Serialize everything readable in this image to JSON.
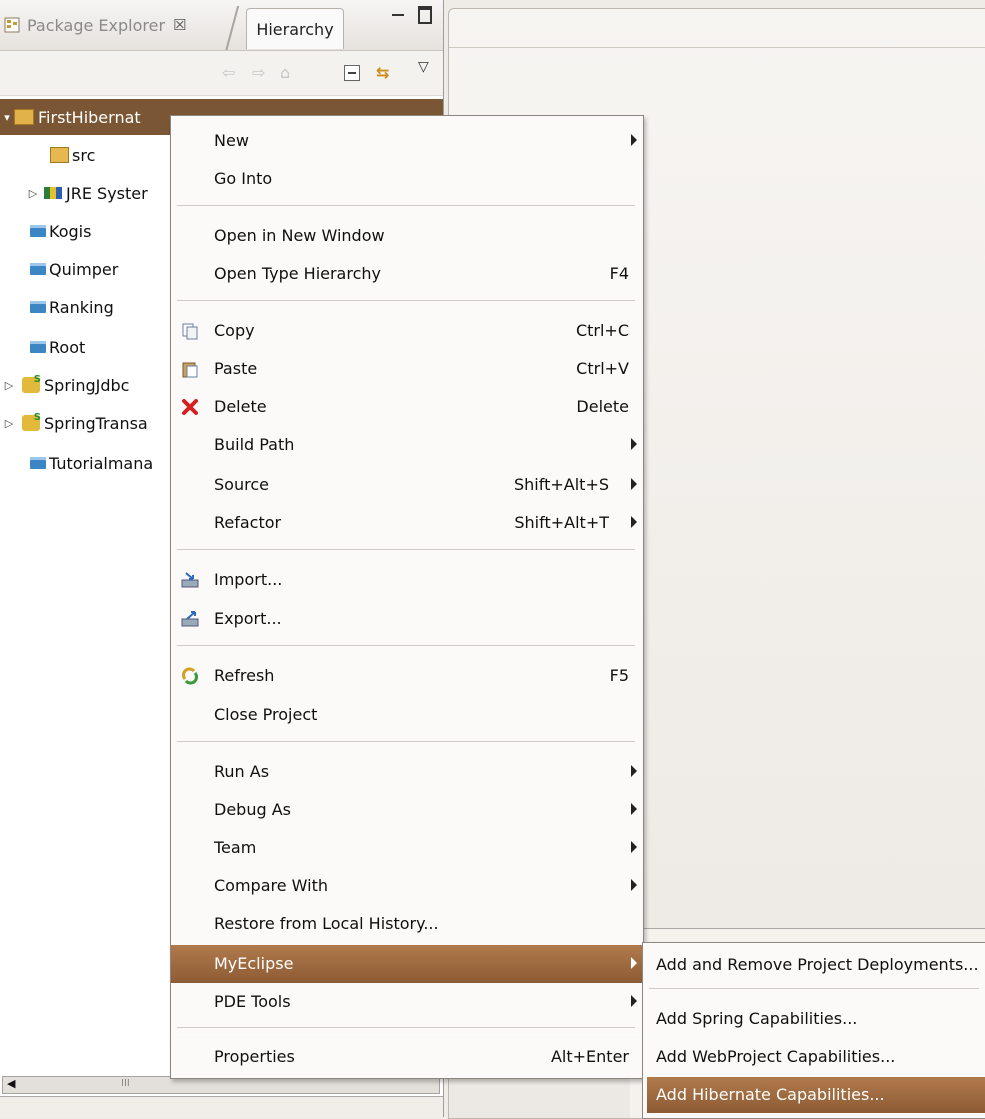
{
  "explorer": {
    "tab_title": "Package Explorer",
    "tab_close": "☒",
    "hierarchy_tab": "Hierarchy",
    "toolbar": {
      "back": "⇦",
      "forward": "⇨",
      "home": "⌂",
      "link": "⇆",
      "menu": "▽"
    },
    "tree": [
      {
        "label": "FirstHibernat",
        "icon": "open-project-icon",
        "expander": "▾"
      },
      {
        "label": "src",
        "icon": "source-folder-icon"
      },
      {
        "label": "JRE Syster",
        "icon": "library-icon",
        "expander": "▷"
      },
      {
        "label": "Kogis",
        "icon": "folder-icon"
      },
      {
        "label": "Quimper",
        "icon": "folder-icon"
      },
      {
        "label": "Ranking",
        "icon": "folder-icon"
      },
      {
        "label": "Root",
        "icon": "folder-icon"
      },
      {
        "label": "SpringJdbc",
        "icon": "spring-project-icon",
        "expander": "▷"
      },
      {
        "label": "SpringTransa",
        "icon": "spring-project-icon",
        "expander": "▷"
      },
      {
        "label": "Tutorialmana",
        "icon": "folder-icon"
      }
    ],
    "scroll_left": "◀",
    "scroll_grip": "III"
  },
  "context_menu": {
    "items": [
      {
        "label": "New",
        "submenu": true
      },
      {
        "label": "Go Into"
      },
      {
        "label": "Open in New Window"
      },
      {
        "label": "Open Type Hierarchy",
        "shortcut": "F4"
      },
      {
        "label": "Copy",
        "shortcut": "Ctrl+C",
        "icon": "copy-icon"
      },
      {
        "label": "Paste",
        "shortcut": "Ctrl+V",
        "icon": "paste-icon"
      },
      {
        "label": "Delete",
        "shortcut": "Delete",
        "icon": "delete-icon"
      },
      {
        "label": "Build Path",
        "submenu": true
      },
      {
        "label": "Source",
        "shortcut": "Shift+Alt+S",
        "submenu": true
      },
      {
        "label": "Refactor",
        "shortcut": "Shift+Alt+T",
        "submenu": true
      },
      {
        "label": "Import...",
        "icon": "import-icon"
      },
      {
        "label": "Export...",
        "icon": "export-icon"
      },
      {
        "label": "Refresh",
        "shortcut": "F5",
        "icon": "refresh-icon"
      },
      {
        "label": "Close Project"
      },
      {
        "label": "Run As",
        "submenu": true
      },
      {
        "label": "Debug As",
        "submenu": true
      },
      {
        "label": "Team",
        "submenu": true
      },
      {
        "label": "Compare With",
        "submenu": true
      },
      {
        "label": "Restore from Local History..."
      },
      {
        "label": "MyEclipse",
        "submenu": true,
        "highlighted": true
      },
      {
        "label": "PDE Tools",
        "submenu": true
      },
      {
        "label": "Properties",
        "shortcut": "Alt+Enter"
      }
    ]
  },
  "submenu": {
    "items": [
      {
        "label": "Add and Remove Project Deployments..."
      },
      {
        "label": "Add Spring Capabilities..."
      },
      {
        "label": "Add WebProject Capabilities..."
      },
      {
        "label": "Add Hibernate Capabilities...",
        "highlighted": true
      }
    ]
  },
  "colors": {
    "selection": "#7a5634",
    "highlight": "#9d6b42",
    "menu_bg": "#fbfaf9"
  }
}
